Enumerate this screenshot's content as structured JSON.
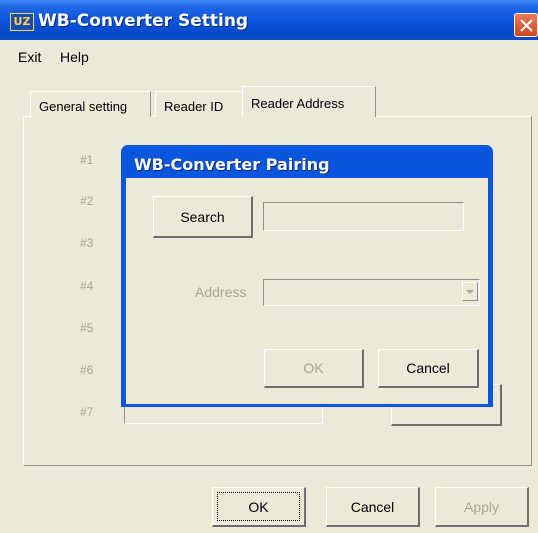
{
  "window": {
    "title": "WB-Converter Setting",
    "icon": "app-logo-icon"
  },
  "menu": [
    {
      "label": "Exit"
    },
    {
      "label": "Help"
    }
  ],
  "tabs": [
    {
      "label": "General setting"
    },
    {
      "label": "Reader ID"
    },
    {
      "label": "Reader Address",
      "active": true
    }
  ],
  "reader_rows": [
    "#1",
    "#2",
    "#3",
    "#4",
    "#5",
    "#6",
    "#7"
  ],
  "dialog": {
    "title": "WB-Converter Pairing",
    "search_label": "Search",
    "search_value": "",
    "address_label": "Address",
    "address_value": "",
    "ok_label": "OK",
    "cancel_label": "Cancel"
  },
  "footer": {
    "ok_label": "OK",
    "cancel_label": "Cancel",
    "apply_label": "Apply"
  },
  "colors": {
    "title_bar": "#0a55dd",
    "window_bg": "#ece9d8",
    "close_button": "#d2451f",
    "disabled_text": "#a8a89a"
  }
}
